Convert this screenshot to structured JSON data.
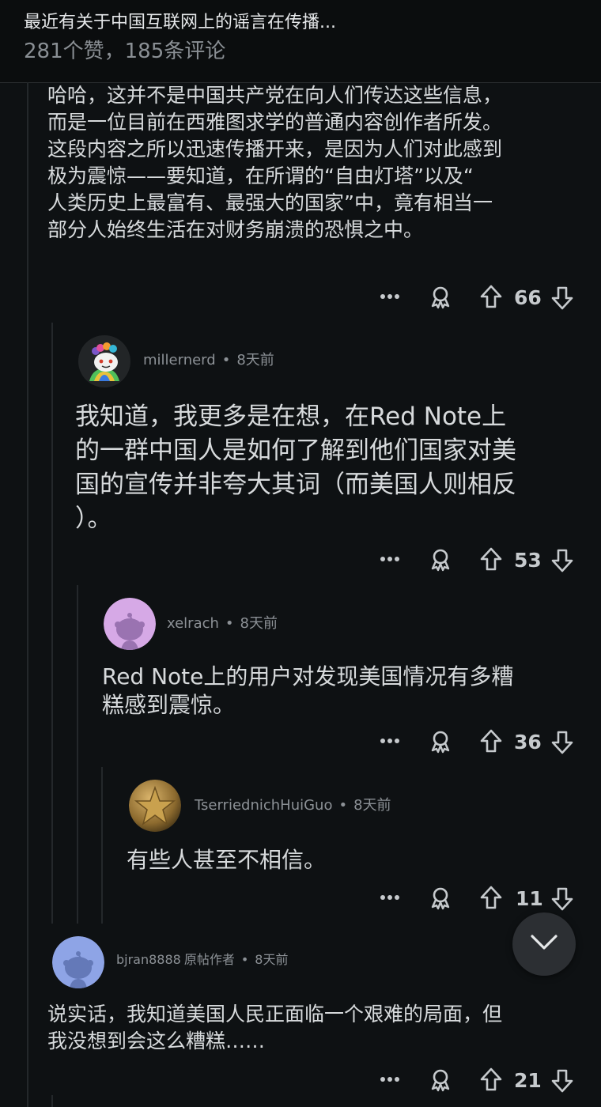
{
  "header": {
    "title": "最近有关于中国互联网上的谣言在传播...",
    "stats": "281个赞，185条评论"
  },
  "comments": [
    {
      "body": [
        "哈哈，这并不是中国共产党在向人们传达这些信息，",
        "而是一位目前在西雅图求学的普通内容创作者所发。",
        "这段内容之所以迅速传播开来，是因为人们对此感到",
        "极为震惊——要知道，在所谓的“自由灯塔”以及“",
        "人类历史上最富有、最强大的国家”中，竟有相当一",
        "部分人始终生活在对财务崩溃的恐惧之中。"
      ],
      "score": "66"
    },
    {
      "author": "millernerd",
      "time": "8天前",
      "body": [
        "我知道，我更多是在想，在Red Note上",
        "的一群中国人是如何了解到他们国家对美",
        "国的宣传并非夸大其词（而美国人则相反",
        "）。"
      ],
      "score": "53"
    },
    {
      "author": "xelrach",
      "time": "8天前",
      "body": [
        "Red Note上的用户对发现美国情况有多糟",
        "糕感到震惊。"
      ],
      "score": "36"
    },
    {
      "author": "TserriednichHuiGuo",
      "time": "8天前",
      "body": [
        "有些人甚至不相信。"
      ],
      "score": "11"
    },
    {
      "author": "bjran8888",
      "op_label": "原帖作者",
      "time": "8天前",
      "body": [
        "说实话，我知道美国人民正面临一个艰难的局面，但",
        "我没想到会这么糟糕……"
      ],
      "score": "21"
    }
  ],
  "icons": {
    "more": "more-options-icon",
    "award": "award-icon",
    "upvote": "upvote-arrow-icon",
    "downvote": "downvote-arrow-icon",
    "scroll": "chevron-down-icon"
  },
  "colors": {
    "background": "#0e1113",
    "text": "#d7dadc",
    "meta": "#8c9196"
  }
}
